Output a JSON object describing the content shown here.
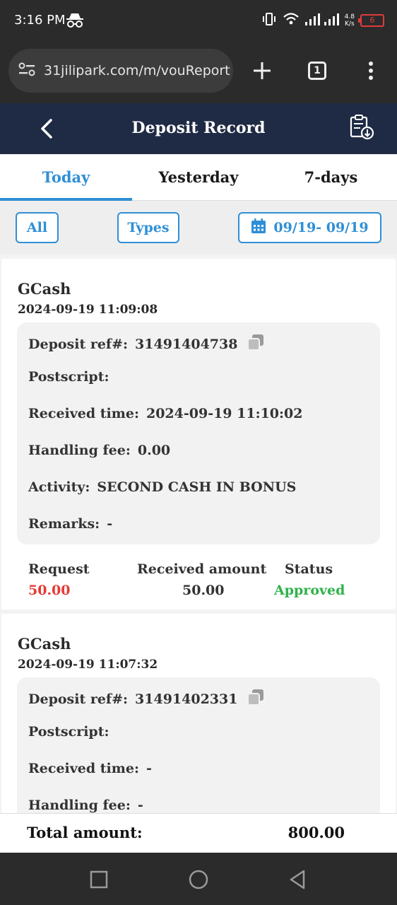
{
  "status_bar": {
    "time": "3:16 PM",
    "net_speed_value": "4.8",
    "net_speed_unit": "K/s",
    "battery": "6"
  },
  "browser": {
    "url": "31jilipark.com/m/vouReport",
    "tab_count": "1"
  },
  "header": {
    "title": "Deposit Record"
  },
  "tabs": [
    {
      "label": "Today",
      "active": true
    },
    {
      "label": "Yesterday",
      "active": false
    },
    {
      "label": "7-days",
      "active": false
    }
  ],
  "filters": {
    "all_label": "All",
    "types_label": "Types",
    "date_range": "09/19- 09/19"
  },
  "records": [
    {
      "source": "GCash",
      "datetime": "2024-09-19 11:09:08",
      "ref_label": "Deposit ref#:",
      "ref": "31491404738",
      "postscript_label": "Postscript:",
      "postscript": "",
      "received_time_label": "Received time:",
      "received_time": "2024-09-19 11:10:02",
      "handling_fee_label": "Handling fee:",
      "handling_fee": "0.00",
      "activity_label": "Activity:",
      "activity": "SECOND CASH IN BONUS",
      "remarks_label": "Remarks:",
      "remarks": "-",
      "request_label": "Request",
      "request": "50.00",
      "received_amount_label": "Received amount",
      "received_amount": "50.00",
      "status_label": "Status",
      "status": "Approved"
    },
    {
      "source": "GCash",
      "datetime": "2024-09-19 11:07:32",
      "ref_label": "Deposit ref#:",
      "ref": "31491402331",
      "postscript_label": "Postscript:",
      "postscript": "",
      "received_time_label": "Received time:",
      "received_time": "-",
      "handling_fee_label": "Handling fee:",
      "handling_fee": "-"
    }
  ],
  "total": {
    "label": "Total amount:",
    "value": "800.00"
  },
  "colors": {
    "accent": "#2f8fd6",
    "header_bg": "#1f2a44",
    "request_red": "#e53935",
    "approved_green": "#2fb24a"
  }
}
